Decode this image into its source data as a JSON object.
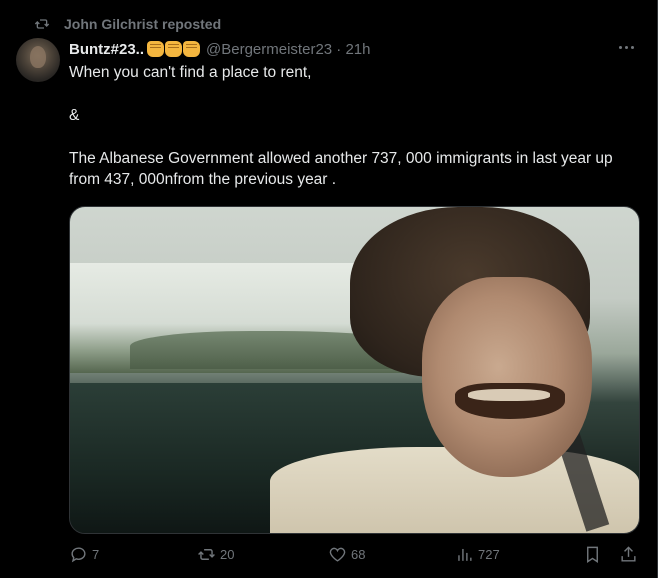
{
  "repost": {
    "text": "John Gilchrist reposted",
    "icon": "retweet-icon"
  },
  "post": {
    "display_name": "Buntz#23..",
    "name_emojis": [
      "fist-emoji",
      "fist-emoji",
      "fist-emoji"
    ],
    "handle_time": "@Bergermeister23 · 21h",
    "text_lines": [
      "When you can't find a place to rent,",
      "&",
      "The Albanese Government allowed another 737, 000 immigrants in last year up from 437, 000nfrom the previous year ."
    ],
    "media_alt": "man laughing in a car"
  },
  "actions": {
    "replies": "7",
    "reposts": "20",
    "likes": "68",
    "views": "727"
  },
  "colors": {
    "background": "#000000",
    "text": "#e7e9ea",
    "muted": "#71767b",
    "emoji": "#f4b63f"
  }
}
